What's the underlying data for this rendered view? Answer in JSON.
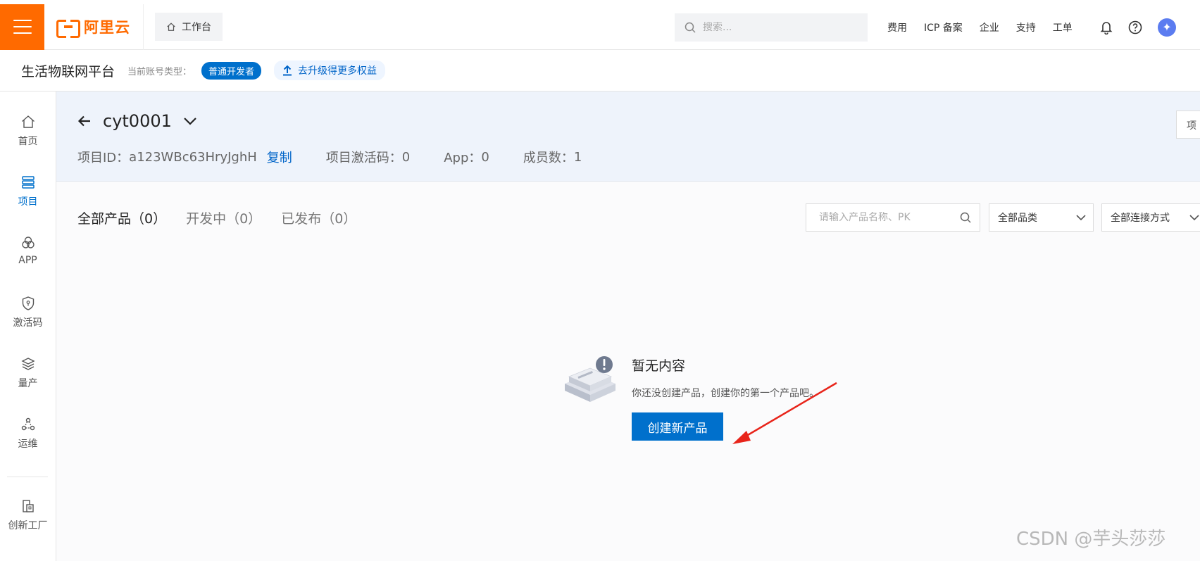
{
  "topbar": {
    "logo_text": "阿里云",
    "workbench_label": "工作台",
    "search_placeholder": "搜索...",
    "nav": [
      "费用",
      "ICP 备案",
      "企业",
      "支持",
      "工单"
    ],
    "brand_color": "#ff6a00"
  },
  "subbar": {
    "platform_name": "生活物联网平台",
    "account_type_label": "当前账号类型：",
    "account_type_value": "普通开发者",
    "upgrade_label": "去升级得更多权益"
  },
  "sidebar": {
    "items": [
      {
        "label": "首页",
        "icon": "home-icon"
      },
      {
        "label": "项目",
        "icon": "project-icon",
        "active": true
      },
      {
        "label": "APP",
        "icon": "app-icon"
      },
      {
        "label": "激活码",
        "icon": "shield-icon"
      },
      {
        "label": "量产",
        "icon": "layers-icon"
      },
      {
        "label": "运维",
        "icon": "ops-icon"
      },
      {
        "label": "创新工厂",
        "icon": "factory-icon"
      }
    ]
  },
  "project": {
    "name": "cyt0001",
    "id_label": "项目ID：",
    "id_value": "a123WBc63HryJghH",
    "copy_label": "复制",
    "activation_label": "项目激活码：",
    "activation_value": "0",
    "app_label": "App：",
    "app_value": "0",
    "members_label": "成员数：",
    "members_value": "1",
    "right_button_label": "项"
  },
  "tabs": [
    {
      "label": "全部产品（0）",
      "active": true
    },
    {
      "label": "开发中（0）"
    },
    {
      "label": "已发布（0）"
    }
  ],
  "filters": {
    "search_placeholder": "请输入产品名称、PK",
    "category": "全部品类",
    "connection": "全部连接方式"
  },
  "empty_state": {
    "title": "暂无内容",
    "description": "你还没创建产品，创建你的第一个产品吧。",
    "button_label": "创建新产品"
  },
  "watermark": "CSDN @芋头莎莎",
  "accent_color": "#0070cc"
}
